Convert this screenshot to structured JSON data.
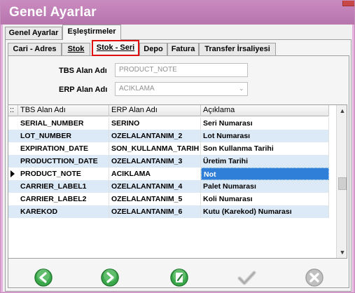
{
  "window": {
    "title": "Genel Ayarlar"
  },
  "outer_tabs": [
    {
      "label": "Genel Ayarlar",
      "active": false
    },
    {
      "label": "Eşleştirmeler",
      "active": true
    }
  ],
  "inner_tabs": [
    {
      "label": "Cari - Adres",
      "active": false
    },
    {
      "label": "Stok",
      "active": false
    },
    {
      "label": "Stok - Seri",
      "active": true
    },
    {
      "label": "Depo",
      "active": false
    },
    {
      "label": "Fatura",
      "active": false
    },
    {
      "label": "Transfer İrsaliyesi",
      "active": false
    }
  ],
  "form": {
    "tbs_label": "TBS Alan Adı",
    "tbs_value": "PRODUCT_NOTE",
    "erp_label": "ERP Alan Adı",
    "erp_value": "ACIKLAMA"
  },
  "grid": {
    "corner": "::",
    "columns": [
      "TBS Alan Adı",
      "ERP Alan Adı",
      "Açıklama"
    ],
    "rows": [
      [
        "SERIAL_NUMBER",
        "SERINO",
        "Seri Numarası"
      ],
      [
        "LOT_NUMBER",
        "OZELALANTANIM_2",
        "Lot Numarası"
      ],
      [
        "EXPIRATION_DATE",
        "SON_KULLANMA_TARIH",
        "Son Kullanma Tarihi"
      ],
      [
        "PRODUCTTION_DATE",
        "OZELALANTANIM_3",
        "Üretim Tarihi"
      ],
      [
        "PRODUCT_NOTE",
        "ACIKLAMA",
        "Not"
      ],
      [
        "CARRIER_LABEL1",
        "OZELALANTANIM_4",
        "Palet Numarası"
      ],
      [
        "CARRIER_LABEL2",
        "OZELALANTANIM_5",
        "Koli Numarası"
      ],
      [
        "KAREKOD",
        "OZELALANTANIM_6",
        "Kutu (Karekod) Numarası"
      ]
    ],
    "selected_row": 4
  },
  "colors": {
    "title_bar": "#b97aaf",
    "row_alt": "#dce9f7",
    "selection": "#2f7fd8",
    "highlight_frame": "#e01010",
    "nav_green": "#3aa84a",
    "disabled_gray": "#b0b0b0"
  },
  "toolbar": [
    {
      "icon": "arrow-left-icon",
      "enabled": true
    },
    {
      "icon": "arrow-right-icon",
      "enabled": true
    },
    {
      "icon": "edit-icon",
      "enabled": true
    },
    {
      "icon": "checkmark-icon",
      "enabled": false
    },
    {
      "icon": "cancel-icon",
      "enabled": false
    }
  ]
}
